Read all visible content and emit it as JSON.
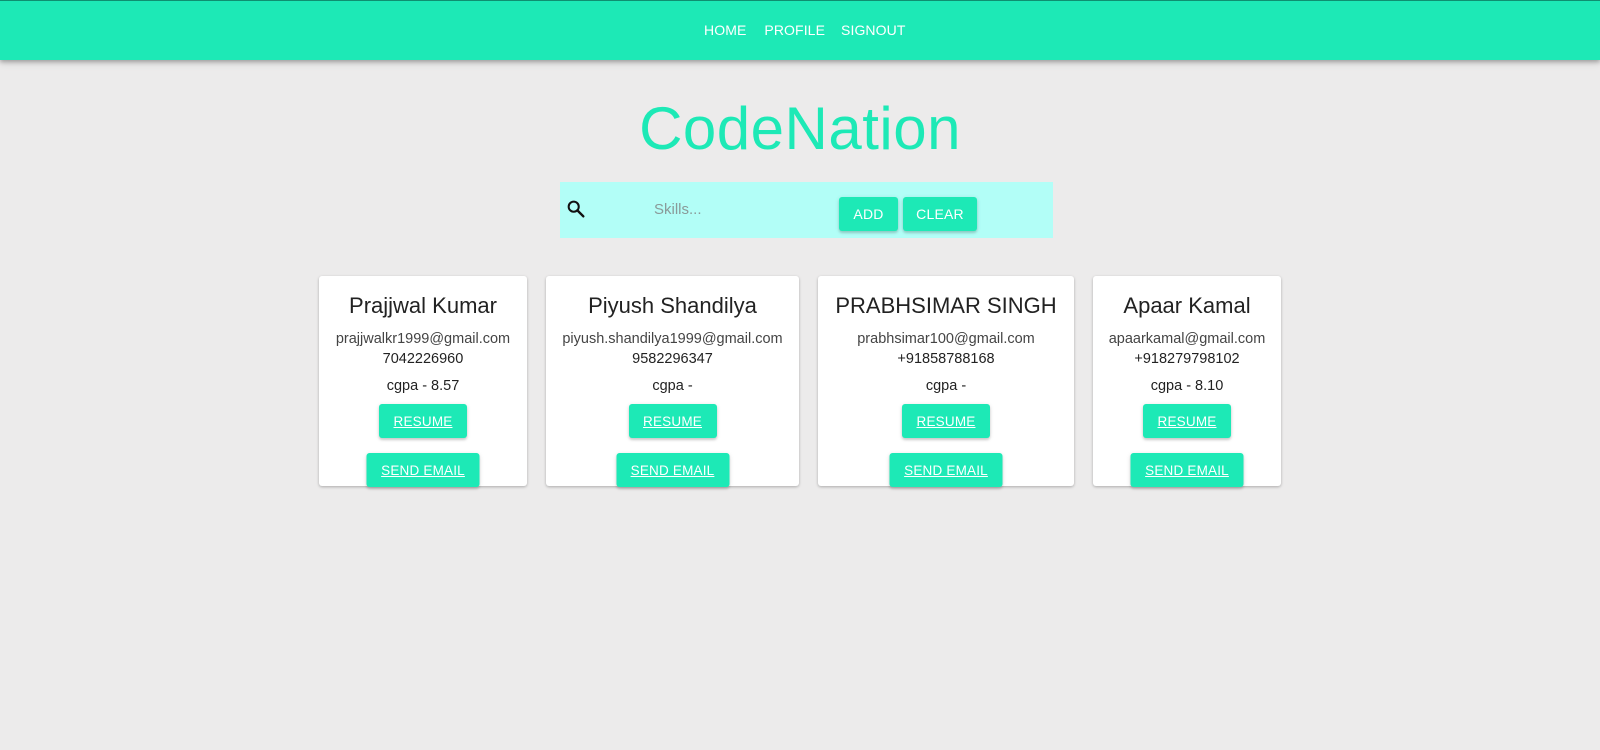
{
  "nav": {
    "links": [
      "HOME",
      "PROFILE",
      "SIGNOUT"
    ]
  },
  "brand": {
    "title": "CodeNation"
  },
  "search": {
    "placeholder": "Skills...",
    "value": "",
    "icon": "search-icon",
    "add_label": "ADD",
    "clear_label": "CLEAR"
  },
  "colors": {
    "accent": "#1de9b6",
    "search_bg": "#b2fef7",
    "page_bg": "#ecebeb"
  },
  "candidates": [
    {
      "name": "Prajjwal Kumar",
      "email": "prajjwalkr1999@gmail.com",
      "phone": "7042226960",
      "cgpa": "cgpa - 8.57",
      "resume_label": "RESUME",
      "email_label": "SEND EMAIL"
    },
    {
      "name": "Piyush Shandilya",
      "email": "piyush.shandilya1999@gmail.com",
      "phone": "9582296347",
      "cgpa": "cgpa -",
      "resume_label": "RESUME",
      "email_label": "SEND EMAIL"
    },
    {
      "name": "PRABHSIMAR SINGH",
      "email": "prabhsimar100@gmail.com",
      "phone": "+91858788168",
      "cgpa": "cgpa -",
      "resume_label": "RESUME",
      "email_label": "SEND EMAIL"
    },
    {
      "name": "Apaar Kamal",
      "email": "apaarkamal@gmail.com",
      "phone": "+918279798102",
      "cgpa": "cgpa - 8.10",
      "resume_label": "RESUME",
      "email_label": "SEND EMAIL"
    }
  ]
}
